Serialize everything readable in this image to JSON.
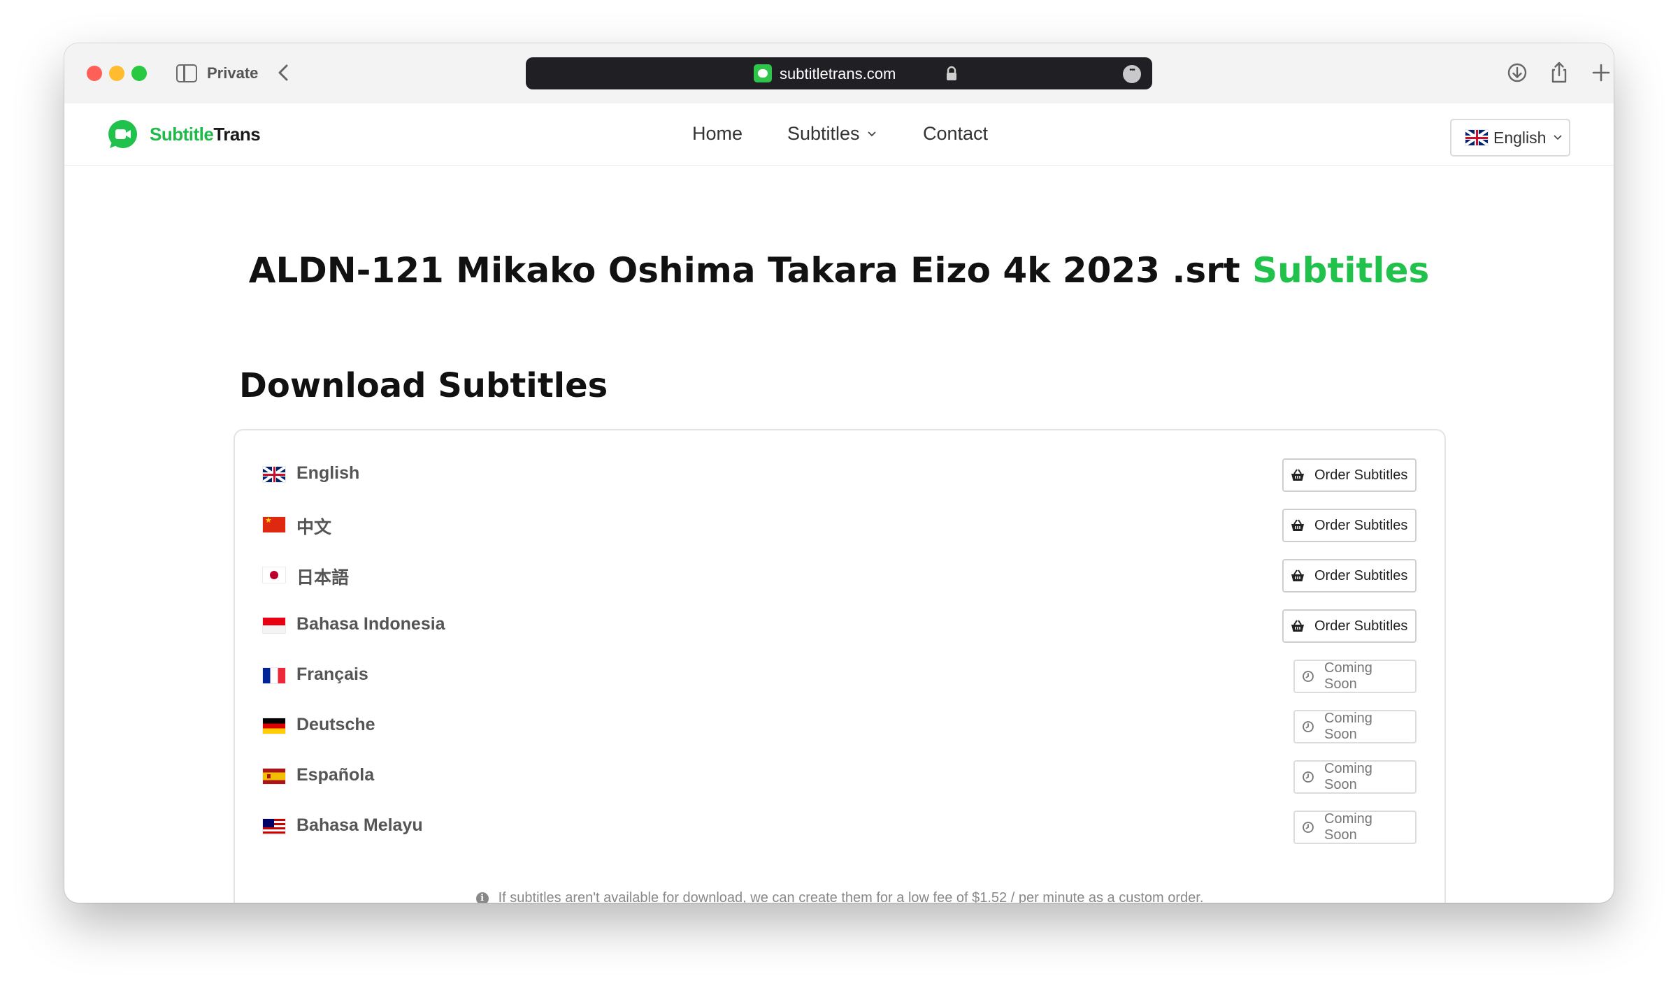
{
  "browser": {
    "private_label": "Private",
    "url": "subtitletrans.com"
  },
  "site": {
    "logo_part1": "Subtitle",
    "logo_part2": "Trans",
    "nav": {
      "home": "Home",
      "subtitles": "Subtitles",
      "contact": "Contact"
    },
    "language_selector": "English",
    "accent_color": "#21c24c"
  },
  "page": {
    "title": "ALDN-121 Mikako Oshima Takara Eizo 4k 2023 .srt",
    "title_accent": "Subtitles",
    "section_title": "Download Subtitles",
    "languages": [
      {
        "label": "English",
        "flag": "gb-flag",
        "action": "Order Subtitles"
      },
      {
        "label": "中文",
        "flag": "cn-flag",
        "action": "Order Subtitles"
      },
      {
        "label": "日本語",
        "flag": "jp-flag",
        "action": "Order Subtitles"
      },
      {
        "label": "Bahasa Indonesia",
        "flag": "id-flag",
        "action": "Order Subtitles"
      },
      {
        "label": "Français",
        "flag": "fr-flag",
        "action": "Coming Soon"
      },
      {
        "label": "Deutsche",
        "flag": "de-flag",
        "action": "Coming Soon"
      },
      {
        "label": "Española",
        "flag": "es-flag",
        "action": "Coming Soon"
      },
      {
        "label": "Bahasa Melayu",
        "flag": "my-flag",
        "action": "Coming Soon"
      }
    ],
    "note": "If subtitles aren't available for download, we can create them for a low fee of $1.52 / per minute as a custom order."
  }
}
